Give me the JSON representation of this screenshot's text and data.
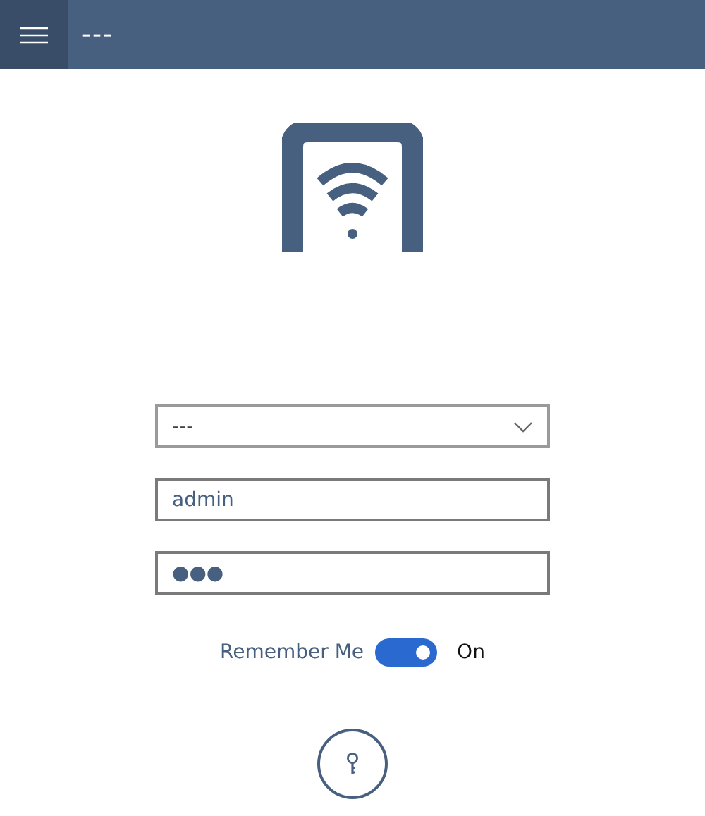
{
  "header": {
    "title": "---"
  },
  "server_select": {
    "value": "---"
  },
  "username": {
    "value": "admin"
  },
  "password": {
    "value": "●●●"
  },
  "remember": {
    "label": "Remember Me",
    "on": true,
    "state_text": "On"
  }
}
